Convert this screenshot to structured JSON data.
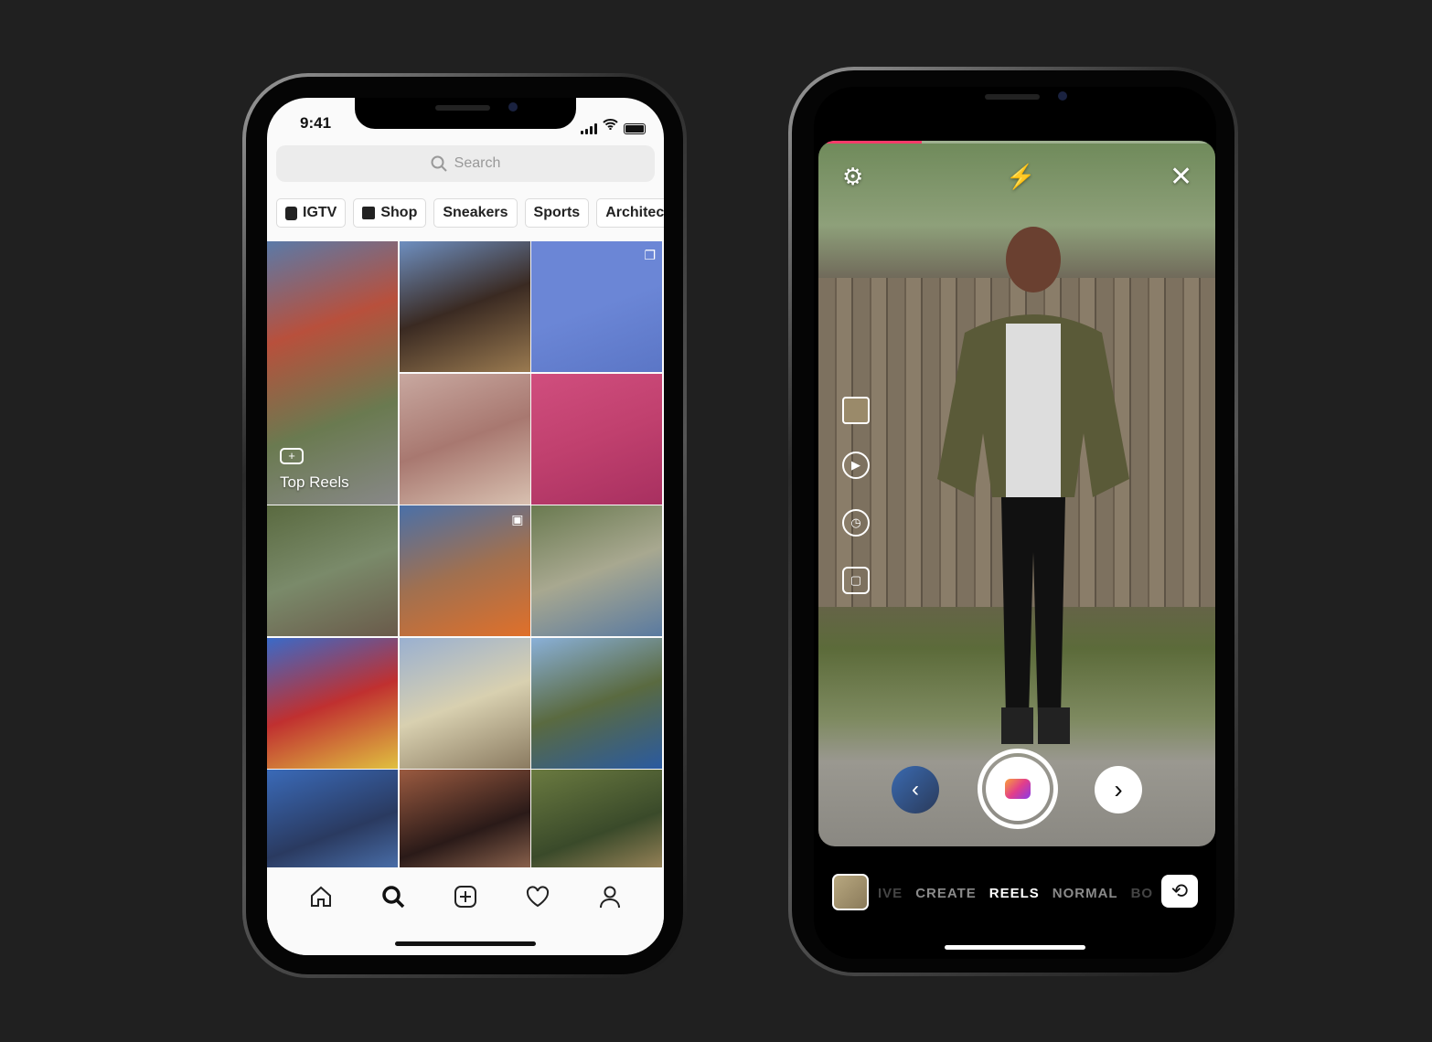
{
  "left_phone": {
    "status": {
      "time": "9:41"
    },
    "search": {
      "placeholder": "Search",
      "icon": "search-icon"
    },
    "chips": [
      {
        "label": "IGTV",
        "icon": "igtv-icon"
      },
      {
        "label": "Shop",
        "icon": "shopping-bag-icon"
      },
      {
        "label": "Sneakers"
      },
      {
        "label": "Sports"
      },
      {
        "label": "Architect"
      }
    ],
    "top_reels_label": "Top Reels",
    "grid_tiles": [
      {
        "colors": [
          "#5a7aa8",
          "#b8503c",
          "#6a7a50",
          "#888"
        ],
        "kind": "top-reels"
      },
      {
        "colors": [
          "#6e8fc0",
          "#3a2a22",
          "#9a7a50"
        ]
      },
      {
        "colors": [
          "#6b86d6",
          "#6b86d6",
          "#5b76c6"
        ],
        "overlay": "carousel-icon"
      },
      {
        "colors": [
          "#c8a8a0",
          "#a87870",
          "#d8c0b0"
        ]
      },
      {
        "colors": [
          "#d04e7e",
          "#c0406e",
          "#a83060"
        ]
      },
      {
        "colors": [
          "#5a6a40",
          "#7a8a6a",
          "#6a5a4a"
        ]
      },
      {
        "colors": [
          "#4a70a8",
          "#a07050",
          "#e0702a"
        ],
        "overlay": "video-icon"
      },
      {
        "colors": [
          "#6a7a50",
          "#a8a890",
          "#5a7aa0"
        ]
      },
      {
        "colors": [
          "#3a6ac8",
          "#c03030",
          "#e0c040"
        ]
      },
      {
        "colors": [
          "#9ab0d0",
          "#d8d0b0",
          "#8a7a60"
        ]
      },
      {
        "colors": [
          "#8ab0d8",
          "#5a6a40",
          "#2a5aa0"
        ]
      },
      {
        "colors": [
          "#3a6ab8",
          "#2a3a60",
          "#5a8ad0"
        ]
      },
      {
        "colors": [
          "#9a5a40",
          "#2a1a18",
          "#c08a6a"
        ]
      },
      {
        "colors": [
          "#6a7a40",
          "#3a4a2a",
          "#c8a070"
        ]
      }
    ],
    "nav": [
      "home-icon",
      "search-icon",
      "add-post-icon",
      "heart-icon",
      "profile-icon"
    ]
  },
  "right_phone": {
    "recording_progress_percent": 25,
    "modes": [
      "IVE",
      "CREATE",
      "REELS",
      "NORMAL",
      "BO"
    ],
    "active_mode": "REELS",
    "accent": "#ff3b6a"
  }
}
